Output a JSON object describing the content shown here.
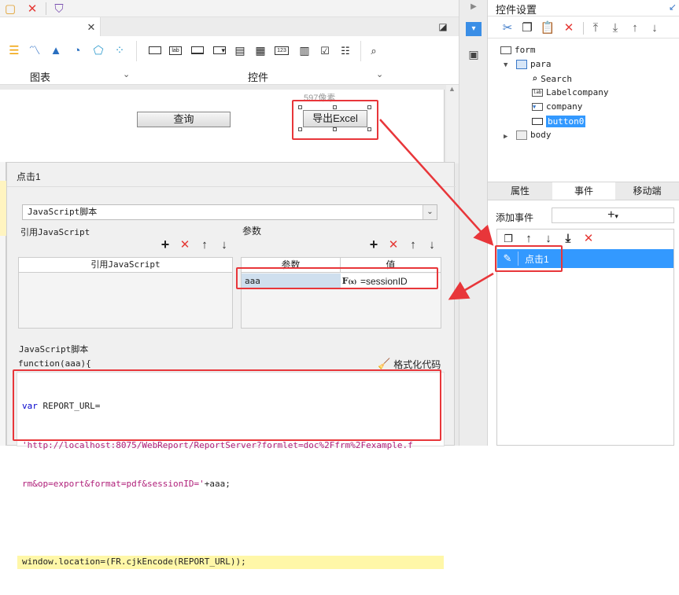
{
  "toolbar": {
    "group_chart_label": "图表",
    "group_control_label": "控件",
    "control_icons": [
      "lab",
      "123"
    ]
  },
  "canvas": {
    "ruler_label": "597像素",
    "query_button": "查询",
    "export_button": "导出Excel"
  },
  "dialog": {
    "title": "点击1",
    "type_select": "JavaScript脚本",
    "ref_js_title": "引用JavaScript",
    "ref_js_column": "引用JavaScript",
    "params_title": "参数",
    "params_columns": [
      "参数",
      "值"
    ],
    "param_row": {
      "name": "aaa",
      "value": "=sessionID"
    },
    "script_section_title": "JavaScript脚本",
    "function_signature": "function(aaa){",
    "format_code_label": "格式化代码",
    "code_lines": [
      {
        "kw": "var",
        "text": " REPORT_URL="
      },
      {
        "str": "'http://localhost:8075/WebReport/ReportServer?formlet=doc%2Ffrm%2Fexample.f"
      },
      {
        "str": "rm&op=export&format=pdf&sessionID='",
        "text": "+aaa;"
      },
      {
        "text": ""
      },
      {
        "text": "window.location=(FR.cjkEncode(REPORT_URL));"
      }
    ]
  },
  "right_panel": {
    "title": "控件设置",
    "tree": {
      "form": "form",
      "para": "para",
      "search": "Search",
      "labelcompany": "Labelcompany",
      "company": "company",
      "button0": "button0",
      "body": "body"
    },
    "tabs": [
      "属性",
      "事件",
      "移动端"
    ],
    "add_event_label": "添加事件",
    "event_item": "点击1",
    "colors": {
      "selected": "#3399ff",
      "highlight_red": "#e8363a"
    }
  }
}
